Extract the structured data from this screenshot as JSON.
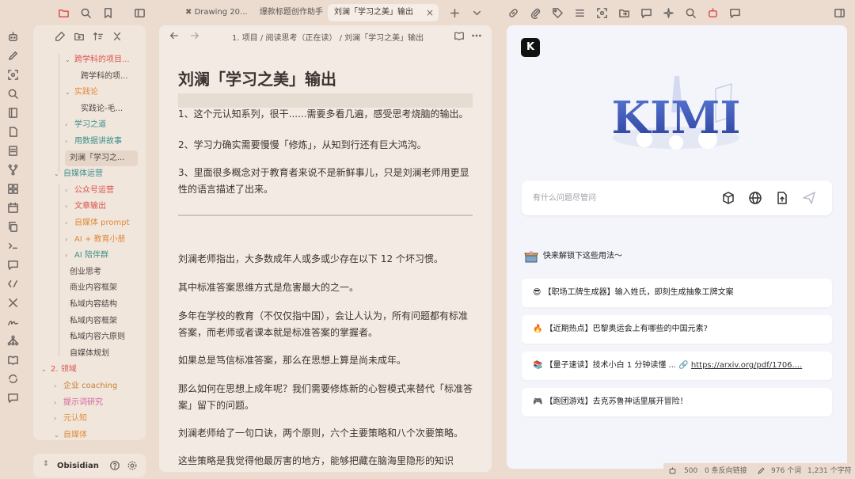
{
  "tabs": [
    {
      "label": "Drawing 20..."
    },
    {
      "label": "爆款标题创作助手"
    },
    {
      "label": "刘澜「学习之美」输出"
    }
  ],
  "sidebar": {
    "items": [
      {
        "label": "跨学科的项目...",
        "depth": 2,
        "expanded": true,
        "color": "#d9534f"
      },
      {
        "label": "跨学科的项...",
        "depth": 3,
        "expanded": null,
        "color": "#4c4642"
      },
      {
        "label": "实践论",
        "depth": 2,
        "expanded": true,
        "color": "#e08a3c"
      },
      {
        "label": "实践论-毛...",
        "depth": 3,
        "expanded": null,
        "color": "#4c4642"
      },
      {
        "label": "学习之道",
        "depth": 2,
        "expanded": false,
        "color": "#3b8f8a"
      },
      {
        "label": "用数据讲故事",
        "depth": 2,
        "expanded": false,
        "color": "#3b8f8a"
      },
      {
        "label": "刘澜「学习之...",
        "depth": 2,
        "expanded": null,
        "color": "#4c4642",
        "selected": true
      },
      {
        "label": "自媒体运营",
        "depth": 1,
        "expanded": true,
        "color": "#3b8f8a"
      },
      {
        "label": "公众号运营",
        "depth": 2,
        "expanded": false,
        "color": "#d9534f"
      },
      {
        "label": "文章输出",
        "depth": 2,
        "expanded": false,
        "color": "#d9534f"
      },
      {
        "label": "自媒体 prompt",
        "depth": 2,
        "expanded": false,
        "color": "#e08a3c"
      },
      {
        "label": "AI + 教育小册",
        "depth": 2,
        "expanded": false,
        "color": "#e08a3c"
      },
      {
        "label": "AI 陪伴群",
        "depth": 2,
        "expanded": false,
        "color": "#3b8f8a"
      },
      {
        "label": "创业思考",
        "depth": 2,
        "expanded": null,
        "color": "#4c4642"
      },
      {
        "label": "商业内容框架",
        "depth": 2,
        "expanded": null,
        "color": "#4c4642"
      },
      {
        "label": "私域内容结构",
        "depth": 2,
        "expanded": null,
        "color": "#4c4642"
      },
      {
        "label": "私域内容框架",
        "depth": 2,
        "expanded": null,
        "color": "#4c4642"
      },
      {
        "label": "私域内容六原则",
        "depth": 2,
        "expanded": null,
        "color": "#4c4642"
      },
      {
        "label": "自媒体规划",
        "depth": 2,
        "expanded": null,
        "color": "#4c4642"
      },
      {
        "label": "2. 领域",
        "depth": 0,
        "expanded": true,
        "color": "#d9534f"
      },
      {
        "label": "企业 coaching",
        "depth": 1,
        "expanded": false,
        "color": "#c2813a"
      },
      {
        "label": "提示词研究",
        "depth": 1,
        "expanded": false,
        "color": "#d0659a"
      },
      {
        "label": "元认知",
        "depth": 1,
        "expanded": false,
        "color": "#e08a3c"
      },
      {
        "label": "自媒体",
        "depth": 1,
        "expanded": true,
        "color": "#e08a3c"
      }
    ],
    "vault_name": "Obisidian"
  },
  "editor": {
    "breadcrumb": "1. 项目 / 阅读思考（正在读） / 刘澜「学习之美」输出",
    "title": "刘澜「学习之美」输出",
    "paragraphs": [
      "1、这个元认知系列，很干......需要多看几遍，感受思考烧脑的输出。",
      "2、学习力确实需要慢慢「修炼」，从知到行还有巨大鸿沟。",
      "3、里面很多概念对于教育者来说不是新鲜事儿，只是刘澜老师用更显性的语言描述了出来。",
      "刘澜老师指出，大多数成年人或多或少存在以下 12 个坏习惯。",
      "其中标准答案思维方式是危害最大的之一。",
      "多年在学校的教育（不仅仅指中国），会让人认为，所有问题都有标准答案，而老师或者课本就是标准答案的掌握者。",
      "如果总是笃信标准答案，那么在思想上算是尚未成年。",
      "那么如何在思想上成年呢？我们需要修炼新的心智模式来替代「标准答案」留下的问题。",
      "刘澜老师给了一句口诀，两个原则，六个主要策略和八个次要策略。",
      "这些策略是我觉得他最厉害的地方，能够把藏在脑海里隐形的知识"
    ]
  },
  "kimi": {
    "logo_text": "K",
    "ask_placeholder": "有什么问题尽管问",
    "unlock_text": "快来解锁下这些用法～",
    "cards": [
      {
        "emoji": "😎",
        "text": "【职场工牌生成器】输入姓氏，即刻生成抽象工牌文案",
        "link": ""
      },
      {
        "emoji": "🔥",
        "text": "【近期热点】巴黎奥运会上有哪些的中国元素?",
        "link": ""
      },
      {
        "emoji": "📚",
        "text": "【量子速读】技术小白 1 分钟读懂 ... 🔗",
        "link": "https://arxiv.org/pdf/1706...."
      },
      {
        "emoji": "🎮",
        "text": "【跑团游戏】去克苏鲁神话里展开冒险！",
        "link": ""
      }
    ],
    "banner_text": "KIMI"
  },
  "status": {
    "bot_count": "500",
    "backlinks": "0 条反向链接",
    "words": "976 个词",
    "chars": "1,231 个字符"
  },
  "colors": {
    "accent": "#d9534f",
    "panel_bg": "#f3ebe3",
    "kimi_bg": "#f4f5fa",
    "kimi_blue": "#3a57b7"
  }
}
